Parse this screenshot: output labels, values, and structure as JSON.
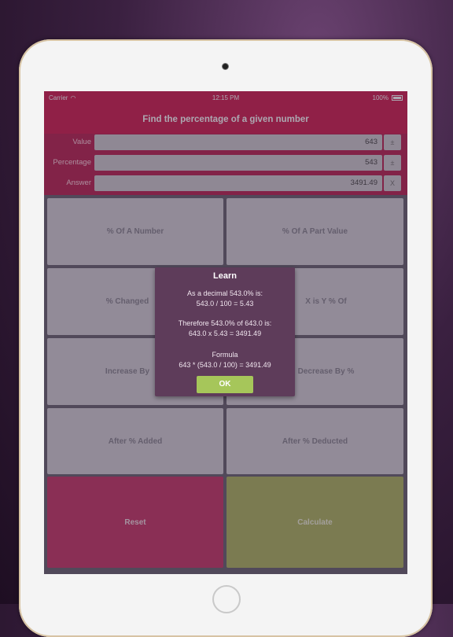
{
  "status": {
    "carrier": "Carrier",
    "time": "12:15 PM",
    "battery": "100%"
  },
  "title": "Find the percentage of a given number",
  "inputs": [
    {
      "label": "Value",
      "value": "643",
      "button": "±"
    },
    {
      "label": "Percentage",
      "value": "543",
      "button": "±"
    },
    {
      "label": "Answer",
      "value": "3491.49",
      "button": "X"
    }
  ],
  "buttons": {
    "pct_of_number": "% Of A Number",
    "pct_of_part": "% Of A Part Value",
    "pct_changed": "% Changed",
    "x_is_y_pct_of": "X is Y % Of",
    "increase_by": "Increase By",
    "decrease_by_pct": "Decrease By %",
    "after_pct_added": "After % Added",
    "after_pct_deducted": "After % Deducted",
    "reset": "Reset",
    "calculate": "Calculate"
  },
  "dialog": {
    "title": "Learn",
    "line1": "As a decimal 543.0% is:",
    "line2": "543.0 / 100 = 5.43",
    "line3": "Therefore 543.0% of 643.0 is:",
    "line4": "643.0 x 5.43 = 3491.49",
    "line5": "Formula",
    "line6": "643 * (543.0 / 100) = 3491.49",
    "ok": "OK"
  }
}
